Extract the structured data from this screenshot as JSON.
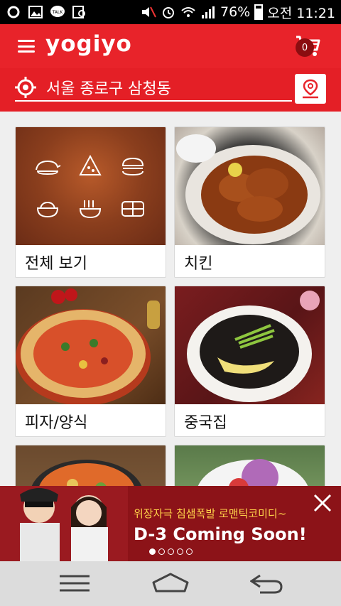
{
  "status_bar": {
    "battery": "76%",
    "time": "오전 11:21"
  },
  "header": {
    "logo": "yogiyo",
    "cart_count": "0"
  },
  "location": {
    "address": "서울 종로구 삼청동"
  },
  "categories": [
    {
      "label": "전체 보기"
    },
    {
      "label": "치킨"
    },
    {
      "label": "피자/양식"
    },
    {
      "label": "중국집"
    },
    {
      "label": ""
    },
    {
      "label": ""
    }
  ],
  "banner": {
    "subtitle": "위장자극 침샘폭발 로맨틱코미디~",
    "title": "D-3  Coming Soon!",
    "page_count": 5,
    "active_page": 1
  },
  "colors": {
    "brand": "#e8232a",
    "banner_bg": "#8c1318",
    "banner_accent": "#ffd24a"
  }
}
